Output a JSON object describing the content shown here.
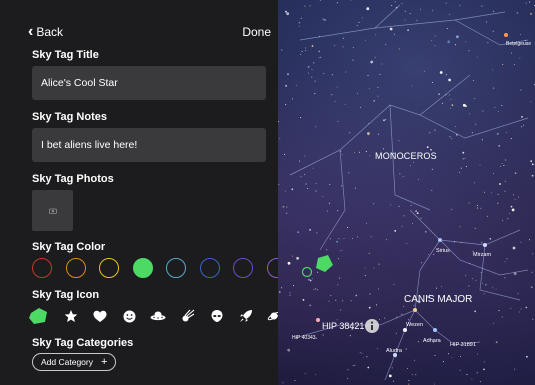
{
  "nav": {
    "back_label": "Back",
    "done_label": "Done"
  },
  "form": {
    "title_label": "Sky Tag Title",
    "title_value": "Alice's Cool Star",
    "notes_label": "Sky Tag Notes",
    "notes_value": "I bet aliens live here!",
    "photos_label": "Sky Tag Photos",
    "color_label": "Sky Tag Color",
    "icon_label": "Sky Tag Icon",
    "categories_label": "Sky Tag Categories",
    "add_category_label": "Add Category",
    "add_category_plus": "+"
  },
  "colors": {
    "swatches": [
      {
        "name": "red",
        "color": "#c0392b",
        "selected": false
      },
      {
        "name": "orange",
        "color": "#d98c1a",
        "selected": false
      },
      {
        "name": "yellow",
        "color": "#e6c21a",
        "selected": false
      },
      {
        "name": "green",
        "color": "#4cd964",
        "selected": true
      },
      {
        "name": "teal",
        "color": "#5aa9c8",
        "selected": false
      },
      {
        "name": "blue",
        "color": "#3a63c8",
        "selected": false
      },
      {
        "name": "purple",
        "color": "#6a4cc8",
        "selected": false
      },
      {
        "name": "violet",
        "color": "#8a5cc8",
        "selected": false
      }
    ],
    "accent": "#4cd964",
    "panel_bg": "#1c1c1e",
    "field_bg": "#3a3a3c"
  },
  "icons": [
    "gem-icon",
    "star-icon",
    "heart-icon",
    "smiley-icon",
    "ufo-icon",
    "comet-icon",
    "alien-icon",
    "rocket-icon",
    "planet-icon"
  ],
  "sky": {
    "constellation_1": "MONOCEROS",
    "constellation_2": "CANIS MAJOR",
    "stars": {
      "betelgeuse": "Betelgeuse",
      "sirius": "Sirius",
      "mirzam": "Mirzam",
      "hip38421": "HIP 38421",
      "hip40343": "HIP 40343",
      "wezen": "Wezen",
      "adhara": "Adhara",
      "aludra": "Aludra",
      "hip31891": "HIP 31891"
    }
  }
}
